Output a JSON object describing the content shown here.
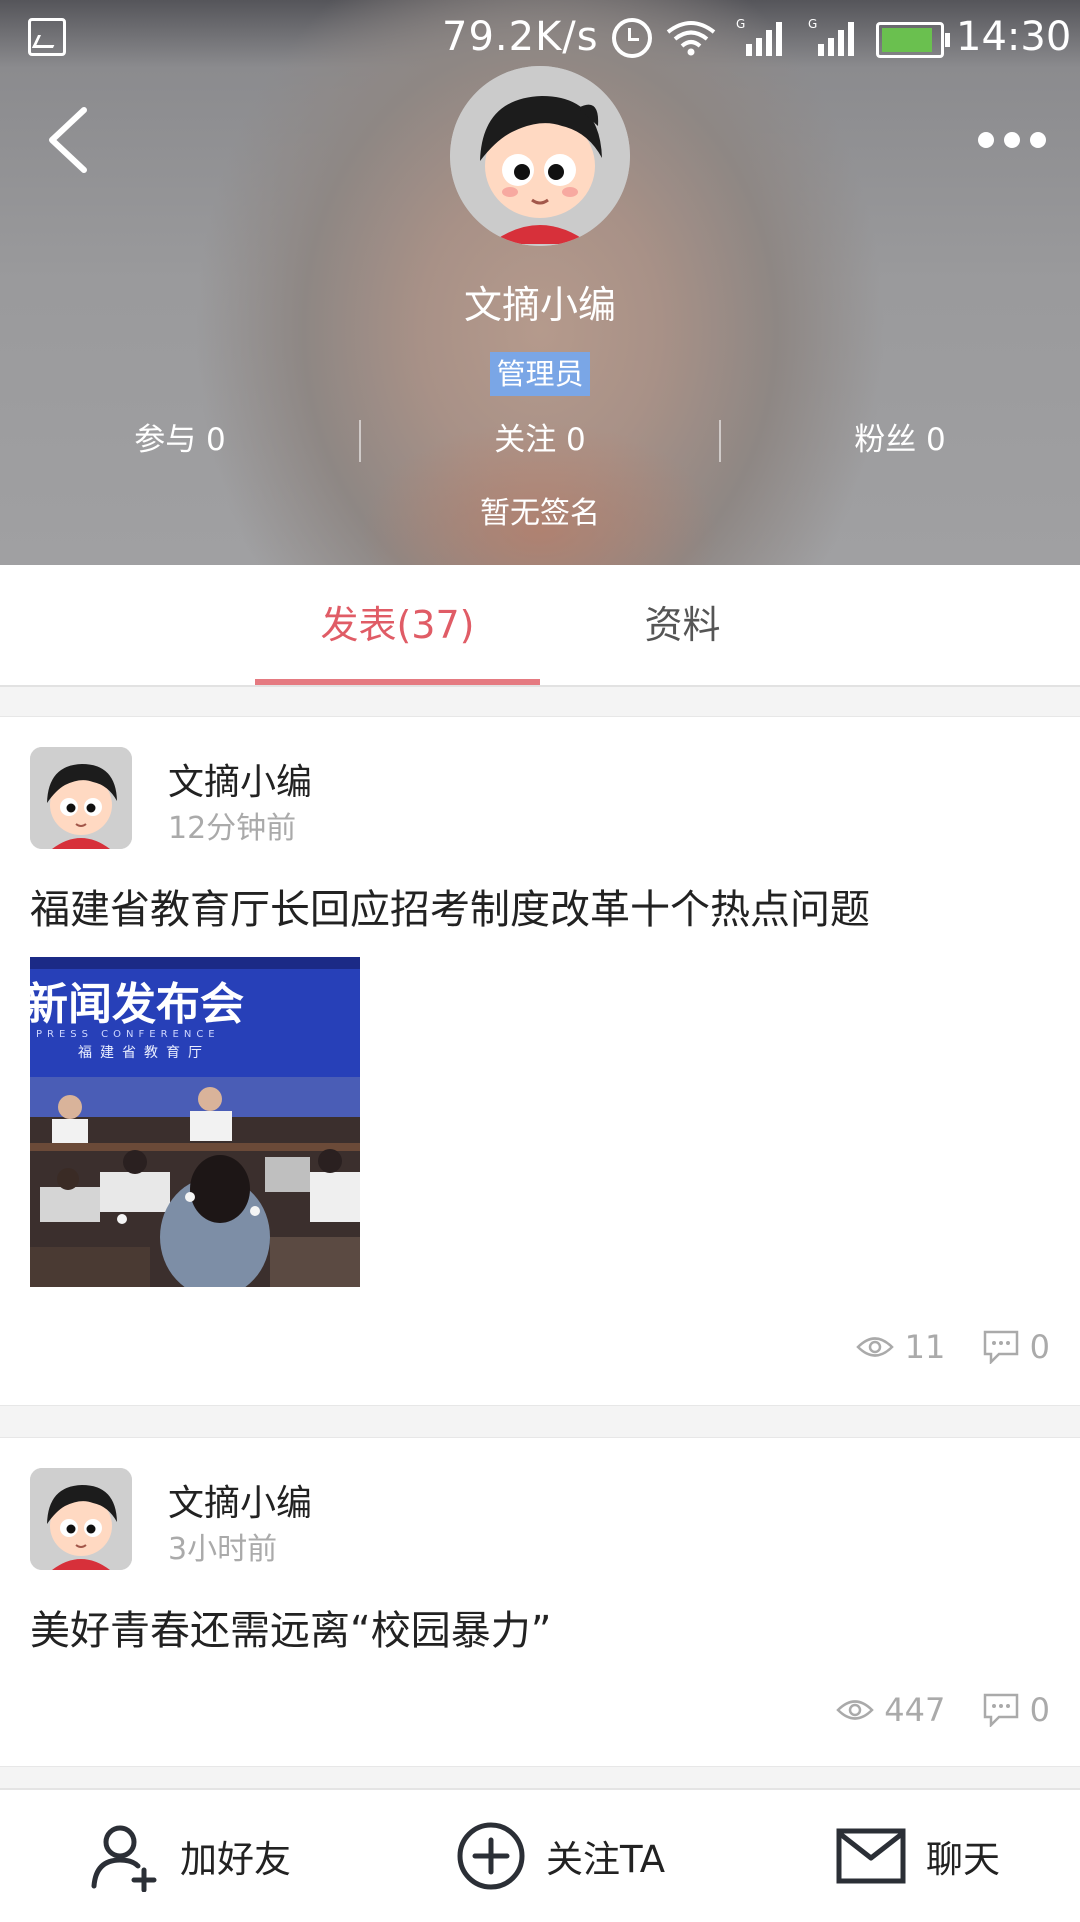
{
  "statusbar": {
    "net_speed": "79.2K/s",
    "time": "14:30",
    "gallery_icon": "image-icon",
    "battery_color": "#6ac04f"
  },
  "header": {
    "name": "文摘小编",
    "role_badge": "管理员",
    "stats": [
      {
        "label": "参与 0"
      },
      {
        "label": "关注 0"
      },
      {
        "label": "粉丝 0"
      }
    ],
    "signature": "暂无签名"
  },
  "tabs": [
    {
      "label": "发表(37)",
      "active": true
    },
    {
      "label": "资料",
      "active": false
    }
  ],
  "accent_color": "#e05c66",
  "posts": [
    {
      "author": "文摘小编",
      "time": "12分钟前",
      "title": "福建省教育厅长回应招考制度改革十个热点问题",
      "image_text": "新闻发布会",
      "image_subtext": "PRESS CONFERENCE",
      "image_org": "福建省教育厅",
      "views": "11",
      "comments": "0"
    },
    {
      "author": "文摘小编",
      "time": "3小时前",
      "title": "美好青春还需远离“校园暴力”",
      "views": "447",
      "comments": "0"
    }
  ],
  "bottombar": {
    "add_friend": "加好友",
    "follow": "关注TA",
    "chat": "聊天"
  }
}
